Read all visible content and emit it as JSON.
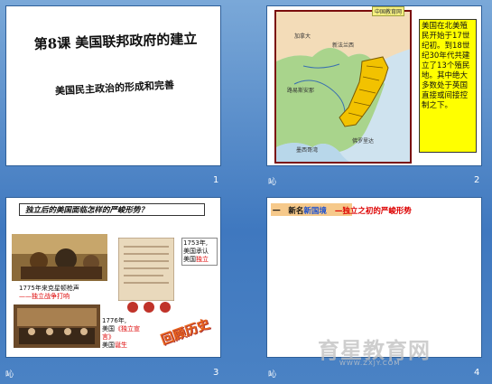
{
  "slides": [
    {
      "number": "1",
      "title": "第8课  美国联邦政府的建立",
      "subtitle": "美国民主政治的形成和完善"
    },
    {
      "number": "2",
      "mark": "吣",
      "badge": "中国教育网",
      "note": "美国在北美殖民开始于17世纪初。到18世纪30年代共建立了13个殖民地。其中绝大多数处于英国直接或间接控制之下。",
      "map_labels": [
        "加拿大",
        "新法兰西",
        "路易斯安那",
        "墨西哥湾",
        "佛罗里达"
      ]
    },
    {
      "number": "3",
      "mark": "吣",
      "question": "独立后的美国面临怎样的严峻形势？",
      "labels": {
        "l1a": "1775年来克星顿枪声",
        "l1b": "——独立战争打响",
        "l2a": "1753年,",
        "l2b": "美国承认",
        "l2c": "美国",
        "l2d": "独立",
        "l3a": "1776年,",
        "l3b": "美国",
        "l3c": "《独立宣言》",
        "l3d": "美国",
        "l3e": "诞生"
      },
      "stamp": "回顾历史"
    },
    {
      "number": "4",
      "mark": "吣",
      "heading_prefix": "一",
      "heading_a": "新名",
      "heading_b": "新国境",
      "heading_c": "—独立之初的严峻形势"
    }
  ],
  "watermark": "育星教育网",
  "watermark_sub": "WWW.ZXJY.COM"
}
